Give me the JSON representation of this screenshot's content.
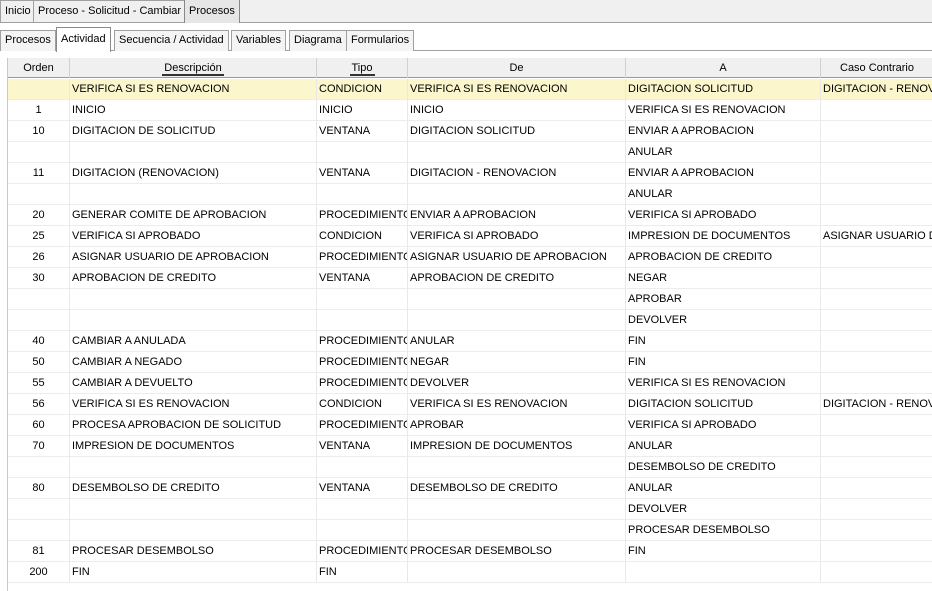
{
  "top_tabs": [
    "Inicio",
    "Proceso - Solicitud - Cambiar",
    "Procesos"
  ],
  "sub_tabs": [
    "Procesos",
    "Actividad",
    "Secuencia / Actividad",
    "Variables",
    "Diagrama",
    "Formularios"
  ],
  "grid": {
    "columns": [
      "Orden",
      "Descripción",
      "Tipo",
      "De",
      "A",
      "Caso Contrario"
    ],
    "rows": [
      [
        "",
        "VERIFICA SI ES RENOVACION",
        "CONDICION",
        "VERIFICA SI ES RENOVACION",
        "DIGITACION SOLICITUD",
        "DIGITACION - RENOVAC"
      ],
      [
        "1",
        "INICIO",
        "INICIO",
        "INICIO",
        "VERIFICA SI ES RENOVACION",
        ""
      ],
      [
        "10",
        "DIGITACION DE SOLICITUD",
        "VENTANA",
        "DIGITACION SOLICITUD",
        "ENVIAR A APROBACION",
        ""
      ],
      [
        "",
        "",
        "",
        "",
        "ANULAR",
        ""
      ],
      [
        "11",
        "DIGITACION (RENOVACION)",
        "VENTANA",
        "DIGITACION - RENOVACION",
        "ENVIAR A APROBACION",
        ""
      ],
      [
        "",
        "",
        "",
        "",
        "ANULAR",
        ""
      ],
      [
        "20",
        "GENERAR COMITE DE APROBACION",
        "PROCEDIMIENTO",
        "ENVIAR A APROBACION",
        "VERIFICA SI APROBADO",
        ""
      ],
      [
        "25",
        "VERIFICA SI APROBADO",
        "CONDICION",
        "VERIFICA SI APROBADO",
        "IMPRESION DE DOCUMENTOS",
        "ASIGNAR USUARIO DE"
      ],
      [
        "26",
        "ASIGNAR USUARIO DE APROBACION",
        "PROCEDIMIENTO",
        "ASIGNAR USUARIO DE APROBACION",
        "APROBACION DE CREDITO",
        ""
      ],
      [
        "30",
        "APROBACION DE CREDITO",
        "VENTANA",
        "APROBACION DE CREDITO",
        "NEGAR",
        ""
      ],
      [
        "",
        "",
        "",
        "",
        "APROBAR",
        ""
      ],
      [
        "",
        "",
        "",
        "",
        "DEVOLVER",
        ""
      ],
      [
        "40",
        "CAMBIAR A ANULADA",
        "PROCEDIMIENTO",
        "ANULAR",
        "FIN",
        ""
      ],
      [
        "50",
        "CAMBIAR A NEGADO",
        "PROCEDIMIENTO",
        "NEGAR",
        "FIN",
        ""
      ],
      [
        "55",
        "CAMBIAR A DEVUELTO",
        "PROCEDIMIENTO",
        "DEVOLVER",
        "VERIFICA SI ES RENOVACION",
        ""
      ],
      [
        "56",
        "VERIFICA SI ES RENOVACION",
        "CONDICION",
        "VERIFICA SI ES RENOVACION",
        "DIGITACION SOLICITUD",
        "DIGITACION - RENOVAC"
      ],
      [
        "60",
        "PROCESA APROBACION DE SOLICITUD",
        "PROCEDIMIENTO",
        "APROBAR",
        "VERIFICA SI APROBADO",
        ""
      ],
      [
        "70",
        "IMPRESION DE DOCUMENTOS",
        "VENTANA",
        "IMPRESION DE DOCUMENTOS",
        "ANULAR",
        ""
      ],
      [
        "",
        "",
        "",
        "",
        "DESEMBOLSO DE CREDITO",
        ""
      ],
      [
        "80",
        "DESEMBOLSO DE CREDITO",
        "VENTANA",
        "DESEMBOLSO DE CREDITO",
        "ANULAR",
        ""
      ],
      [
        "",
        "",
        "",
        "",
        "DEVOLVER",
        ""
      ],
      [
        "",
        "",
        "",
        "",
        "PROCESAR DESEMBOLSO",
        ""
      ],
      [
        "81",
        "PROCESAR DESEMBOLSO",
        "PROCEDIMIENTO",
        "PROCESAR DESEMBOLSO",
        "FIN",
        ""
      ],
      [
        "200",
        "FIN",
        "FIN",
        "",
        "",
        ""
      ]
    ]
  }
}
